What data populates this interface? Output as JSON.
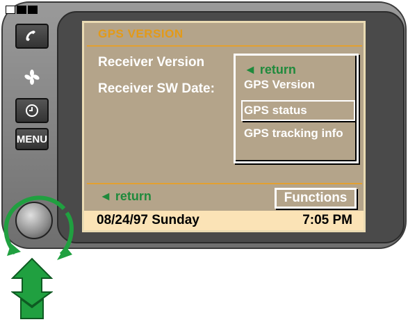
{
  "screen": {
    "title": "GPS VERSION",
    "labels": [
      "Receiver Version",
      "Receiver SW Date:"
    ],
    "menu": {
      "return_label": "◄ return",
      "items": [
        "GPS Version",
        "GPS status",
        "GPS tracking info"
      ],
      "selected": "GPS status"
    },
    "footer": {
      "return_label": "◄  return",
      "functions_label": "Functions"
    },
    "status_bar": {
      "date": "08/24/97 Sunday",
      "time": "7:05 PM"
    }
  },
  "controls": {
    "menu_button": "MENU"
  },
  "colors": {
    "screen_bg": "#b4a48a",
    "title": "#e39a18",
    "return_green": "#1f8a3c",
    "status_bar": "#fbe3b6",
    "arrow_green": "#20a040"
  }
}
